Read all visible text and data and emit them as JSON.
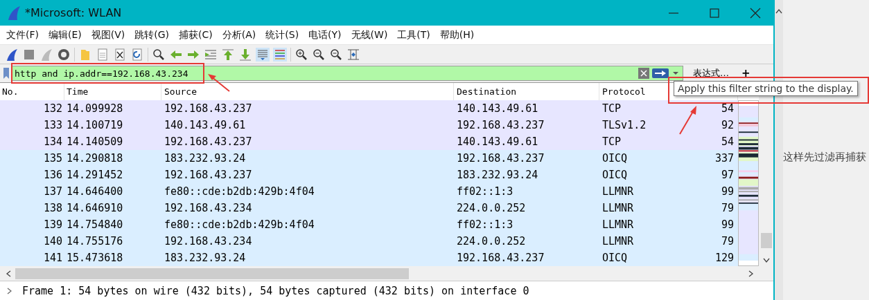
{
  "window": {
    "title": "*Microsoft: WLAN"
  },
  "menu": [
    "文件(F)",
    "编辑(E)",
    "视图(V)",
    "跳转(G)",
    "捕获(C)",
    "分析(A)",
    "统计(S)",
    "电话(Y)",
    "无线(W)",
    "工具(T)",
    "帮助(H)"
  ],
  "filter": {
    "value": "http and ip.addr==192.168.43.234",
    "expression_button": "表达式…",
    "add_button": "+"
  },
  "columns": [
    "No.",
    "Time",
    "Source",
    "Destination",
    "Protocol"
  ],
  "packets": [
    {
      "no": "132",
      "time": "14.099928",
      "source": "192.168.43.237",
      "destination": "140.143.49.61",
      "protocol": "TCP",
      "length": "54",
      "color": "#e7e6ff"
    },
    {
      "no": "133",
      "time": "14.100719",
      "source": "140.143.49.61",
      "destination": "192.168.43.237",
      "protocol": "TLSv1.2",
      "length": "92",
      "color": "#e7e6ff"
    },
    {
      "no": "134",
      "time": "14.140509",
      "source": "192.168.43.237",
      "destination": "140.143.49.61",
      "protocol": "TCP",
      "length": "54",
      "color": "#e7e6ff"
    },
    {
      "no": "135",
      "time": "14.290818",
      "source": "183.232.93.24",
      "destination": "192.168.43.237",
      "protocol": "OICQ",
      "length": "337",
      "color": "#daeeff"
    },
    {
      "no": "136",
      "time": "14.291452",
      "source": "192.168.43.237",
      "destination": "183.232.93.24",
      "protocol": "OICQ",
      "length": "97",
      "color": "#daeeff"
    },
    {
      "no": "137",
      "time": "14.646400",
      "source": "fe80::cde:b2db:429b:4f04",
      "destination": "ff02::1:3",
      "protocol": "LLMNR",
      "length": "99",
      "color": "#daeeff"
    },
    {
      "no": "138",
      "time": "14.646910",
      "source": "192.168.43.234",
      "destination": "224.0.0.252",
      "protocol": "LLMNR",
      "length": "79",
      "color": "#daeeff"
    },
    {
      "no": "139",
      "time": "14.754840",
      "source": "fe80::cde:b2db:429b:4f04",
      "destination": "ff02::1:3",
      "protocol": "LLMNR",
      "length": "99",
      "color": "#daeeff"
    },
    {
      "no": "140",
      "time": "14.755176",
      "source": "192.168.43.234",
      "destination": "224.0.0.252",
      "protocol": "LLMNR",
      "length": "79",
      "color": "#daeeff"
    },
    {
      "no": "141",
      "time": "15.473618",
      "source": "183.232.93.24",
      "destination": "192.168.43.237",
      "protocol": "OICQ",
      "length": "129",
      "color": "#daeeff"
    }
  ],
  "tooltip": "Apply this filter string to the display.",
  "detail": "Frame 1: 54 bytes on wire (432 bits), 54 bytes captured (432 bits) on interface 0",
  "background_text": "这样先过滤再捕获"
}
